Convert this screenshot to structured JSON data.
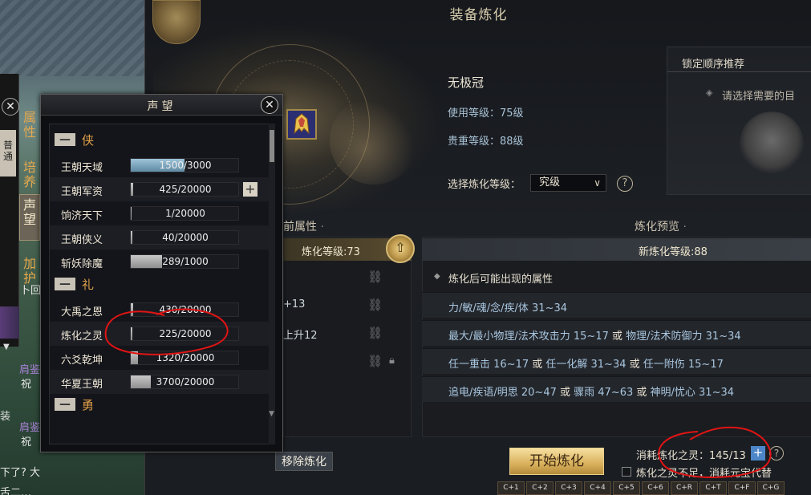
{
  "refine": {
    "title": "装备炼化",
    "item_name": "无极冠",
    "use_level": "使用等级：75级",
    "noble_level": "贵重等级：88级",
    "select_level_label": "选择炼化等级：",
    "select_level_value": "究级",
    "help": "?",
    "lock_panel": {
      "title": "锁定顺序推荐",
      "hint": "请选择需要的目"
    },
    "current_header": "前属性",
    "preview_header": "炼化预览",
    "current_level": "炼化等级:73",
    "current_rows": [
      "",
      "+13",
      "上升12",
      ""
    ],
    "new_level": "新炼化等级:88",
    "preview_subtitle": "炼化后可能出现的属性",
    "preview_rows": [
      {
        "a": "力/敏/魂/念/疾/体 31~34",
        "or1": "",
        "b": "",
        "or2": "",
        "c": ""
      },
      {
        "a": "最大/最小物理/法术攻击力 15~17",
        "or1": " 或 ",
        "b": "物理/法术防御力 31~34",
        "or2": "",
        "c": ""
      },
      {
        "a": "任一重击 16~17",
        "or1": " 或 ",
        "b": "任一化解 31~34",
        "or2": " 或 ",
        "c": "任一附伤 15~17"
      },
      {
        "a": "追电/疾语/明思 20~47",
        "or1": " 或 ",
        "b": "骤雨 47~63",
        "or2": " 或 ",
        "c": "神明/忧心 31~34"
      }
    ],
    "remove_button": "移除炼化",
    "start_button": "开始炼化",
    "consume_label": "消耗炼化之灵：145/13",
    "add": "+",
    "yuanbao_text": "炼化之灵不足，消耗元宝代替",
    "hotkeys": [
      "C+1",
      "C+2",
      "C+3",
      "C+4",
      "C+5",
      "C+6",
      "C+R",
      "C+T",
      "C+F",
      "C+G"
    ]
  },
  "char_panel": {
    "close": "✕",
    "normal_tab": "普通",
    "tabs": [
      "属性",
      "培养",
      "声望",
      "加护"
    ],
    "chat_lines": [
      "卜回",
      "肩鉴",
      "祝",
      "肩鉴",
      "祝"
    ],
    "zhuang": "装",
    "bottom_1": "下了? 大",
    "bottom_2": "舌二…"
  },
  "reputation": {
    "title": "声望",
    "close": "✕",
    "plus": "+",
    "groups": [
      {
        "label": "侠",
        "items": [
          {
            "name": "王朝天域",
            "text": "1500/3000",
            "fill": 0.5,
            "color": "blue"
          },
          {
            "name": "王朝军资",
            "text": "425/20000",
            "fill": 0.021,
            "color": "gray"
          },
          {
            "name": "饷济天下",
            "text": "1/20000",
            "fill": 0.0,
            "color": "gray"
          },
          {
            "name": "王朝侠义",
            "text": "40/20000",
            "fill": 0.002,
            "color": "gray"
          },
          {
            "name": "斩妖除魔",
            "text": "289/1000",
            "fill": 0.289,
            "color": "gray"
          }
        ]
      },
      {
        "label": "礼",
        "items": [
          {
            "name": "大禹之恩",
            "text": "430/20000",
            "fill": 0.0215,
            "color": "gray"
          },
          {
            "name": "炼化之灵",
            "text": "225/20000",
            "fill": 0.011,
            "color": "gray"
          },
          {
            "name": "六爻乾坤",
            "text": "1320/20000",
            "fill": 0.066,
            "color": "gray"
          },
          {
            "name": "华夏王朝",
            "text": "3700/20000",
            "fill": 0.185,
            "color": "gray"
          }
        ]
      },
      {
        "label": "勇",
        "items": []
      }
    ]
  },
  "colors": {
    "accent_gold": "#d9b15c",
    "stat_blue": "#a9c7e0",
    "group_orange": "#e2a24a",
    "annotation_red": "#e01414"
  }
}
